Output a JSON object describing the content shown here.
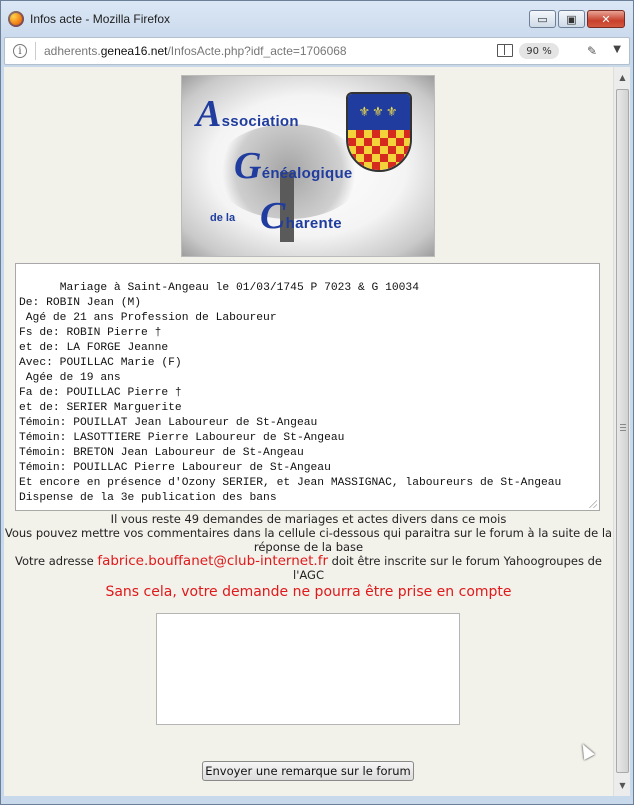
{
  "window": {
    "title": "Infos acte - Mozilla Firefox",
    "minimize_glyph": "▭",
    "maximize_glyph": "▣",
    "close_glyph": "✕"
  },
  "urlbar": {
    "url_prefix": "adherents.",
    "url_domain": "genea16.net",
    "url_path": "/InfosActe.php?idf_acte=1706068",
    "zoom": "90 %",
    "info_glyph": "i",
    "tracking_glyph": "✎",
    "menu_glyph": "▼"
  },
  "logo": {
    "line1_cap": "A",
    "line1_rest": "ssociation",
    "line2_cap": "G",
    "line2_rest": "énéalogique",
    "line3_small": "de la",
    "line3_cap": "C",
    "line3_rest": "harente",
    "shield_glyphs": "⚜⚜⚜"
  },
  "acte": {
    "text": "Mariage à Saint-Angeau le 01/03/1745 P 7023 & G 10034\nDe: ROBIN Jean (M)\n Agé de 21 ans Profession de Laboureur\nFs de: ROBIN Pierre †\net de: LA FORGE Jeanne\nAvec: POUILLAC Marie (F)\n Agée de 19 ans\nFa de: POUILLAC Pierre †\net de: SERIER Marguerite\nTémoin: POUILLAT Jean Laboureur de St-Angeau\nTémoin: LASOTTIERE Pierre Laboureur de St-Angeau\nTémoin: BRETON Jean Laboureur de St-Angeau\nTémoin: POUILLAC Pierre Laboureur de St-Angeau\nEt encore en présence d'Ozony SERIER, et Jean MASSIGNAC, laboureurs de St-Angeau\nDispense de la 3e publication des bans"
  },
  "info": {
    "remaining": "Il vous reste 49 demandes de mariages et actes divers dans ce mois",
    "comment_hint": "Vous pouvez mettre vos commentaires dans la cellule ci-dessous qui paraitra sur le forum à la suite de la réponse de la base",
    "address_prefix": "Votre adresse",
    "email": "fabrice.bouffanet@club-internet.fr",
    "address_suffix": "doit être inscrite sur le forum Yahoogroupes de l'AGC",
    "warning": "Sans cela, votre demande ne pourra être prise en compte"
  },
  "comment": {
    "value": ""
  },
  "send_button": {
    "label": "Envoyer une remarque sur le forum"
  },
  "scrollbar": {
    "up_glyph": "▲",
    "down_glyph": "▼"
  }
}
